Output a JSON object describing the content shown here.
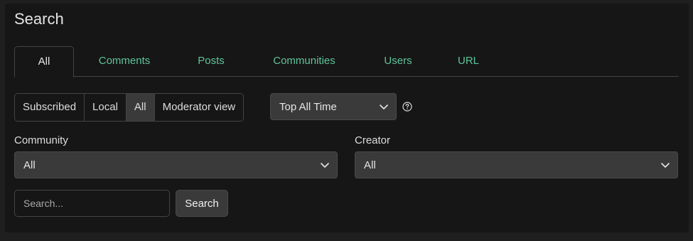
{
  "page": {
    "title": "Search"
  },
  "tabs": [
    {
      "label": "All",
      "active": true
    },
    {
      "label": "Comments",
      "active": false
    },
    {
      "label": "Posts",
      "active": false
    },
    {
      "label": "Communities",
      "active": false
    },
    {
      "label": "Users",
      "active": false
    },
    {
      "label": "URL",
      "active": false
    }
  ],
  "listing_type": {
    "options": [
      "Subscribed",
      "Local",
      "All",
      "Moderator view"
    ],
    "selected": "All"
  },
  "sort": {
    "value": "Top All Time",
    "icon": "chevron-down-icon",
    "help_icon": "question-circle-icon"
  },
  "community": {
    "label": "Community",
    "value": "All"
  },
  "creator": {
    "label": "Creator",
    "value": "All"
  },
  "search": {
    "placeholder": "Search...",
    "value": "",
    "button_label": "Search"
  },
  "colors": {
    "background": "#1f1f1f",
    "panel": "#161616",
    "tab_link": "#5ec49a",
    "control_bg": "#3a3a3a",
    "border": "#444444"
  }
}
